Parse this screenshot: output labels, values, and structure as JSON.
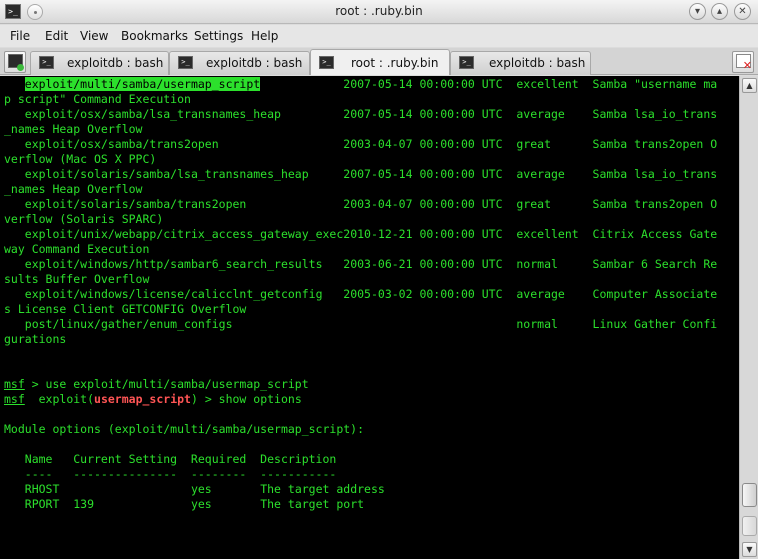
{
  "window": {
    "title": "root : .ruby.bin",
    "buttons": {
      "minimize": "⌃",
      "maximize": "⌃",
      "close": "✕"
    }
  },
  "menu": [
    "File",
    "Edit",
    "View",
    "Bookmarks",
    "Settings",
    "Help"
  ],
  "tabs": [
    {
      "label": "exploitdb : bash",
      "active": false
    },
    {
      "label": "exploitdb : bash",
      "active": false
    },
    {
      "label": "root : .ruby.bin",
      "active": true
    },
    {
      "label": "exploitdb : bash",
      "active": false
    }
  ],
  "terminal": {
    "results": [
      {
        "path": "exploit/multi/samba/usermap_script",
        "date": "2007-05-14 00:00:00 UTC",
        "rank": "excellent",
        "desc_start": "Samba \"username ma",
        "desc_rest": "p script\" Command Execution"
      },
      {
        "path": "exploit/osx/samba/lsa_transnames_heap",
        "date": "2007-05-14 00:00:00 UTC",
        "rank": "average",
        "desc_start": "Samba lsa_io_trans",
        "desc_rest": "_names Heap Overflow"
      },
      {
        "path": "exploit/osx/samba/trans2open",
        "date": "2003-04-07 00:00:00 UTC",
        "rank": "great",
        "desc_start": "Samba trans2open O",
        "desc_rest": "verflow (Mac OS X PPC)"
      },
      {
        "path": "exploit/solaris/samba/lsa_transnames_heap",
        "date": "2007-05-14 00:00:00 UTC",
        "rank": "average",
        "desc_start": "Samba lsa_io_trans",
        "desc_rest": "_names Heap Overflow"
      },
      {
        "path": "exploit/solaris/samba/trans2open",
        "date": "2003-04-07 00:00:00 UTC",
        "rank": "great",
        "desc_start": "Samba trans2open O",
        "desc_rest": "verflow (Solaris SPARC)"
      },
      {
        "path": "exploit/unix/webapp/citrix_access_gateway_exec",
        "date": "2010-12-21 00:00:00 UTC",
        "rank": "excellent",
        "desc_start": "Citrix Access Gate",
        "desc_rest": "way Command Execution"
      },
      {
        "path": "exploit/windows/http/sambar6_search_results",
        "date": "2003-06-21 00:00:00 UTC",
        "rank": "normal",
        "desc_start": "Sambar 6 Search Re",
        "desc_rest": "sults Buffer Overflow"
      },
      {
        "path": "exploit/windows/license/calicclnt_getconfig",
        "date": "2005-03-02 00:00:00 UTC",
        "rank": "average",
        "desc_start": "Computer Associate",
        "desc_rest": "s License Client GETCONFIG Overflow"
      },
      {
        "path": "post/linux/gather/enum_configs",
        "date": "",
        "rank": "normal",
        "desc_start": "Linux Gather Confi",
        "desc_rest": "gurations"
      }
    ],
    "prompt_word": "msf",
    "command1": " > use exploit/multi/samba/usermap_script",
    "prompt2_pre": "  exploit(",
    "prompt2_module": "usermap_script",
    "prompt2_post": ") > show options",
    "module_options_line": "Module options (exploit/multi/samba/usermap_script):",
    "options_header": "   Name   Current Setting  Required  Description",
    "options_separator": "   ----   ---------------  --------  -----------",
    "options": [
      {
        "name": "RHOST",
        "setting": "",
        "required": "yes",
        "description": "The target address"
      },
      {
        "name": "RPORT",
        "setting": "139",
        "required": "yes",
        "description": "The target port"
      }
    ]
  },
  "scrollbar": {
    "up": "▲",
    "down": "▼"
  }
}
